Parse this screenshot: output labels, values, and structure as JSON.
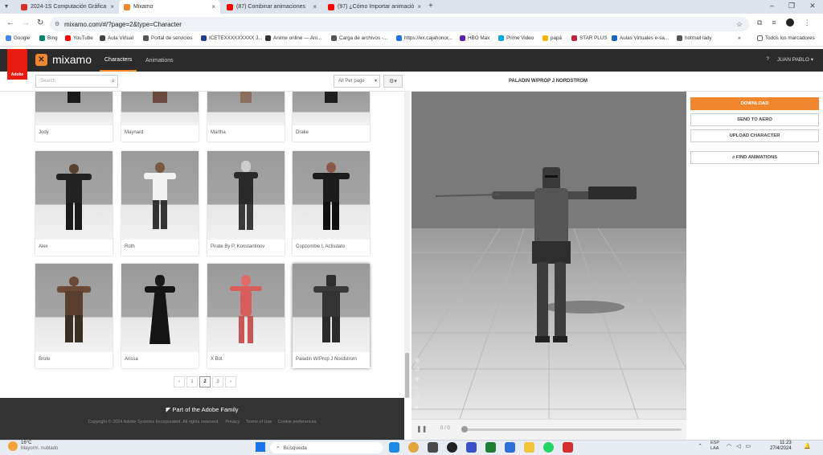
{
  "browser": {
    "tabs": [
      {
        "label": "2024-1S Computación Gráfica",
        "color": "#d93025"
      },
      {
        "label": "Mixamo",
        "color": "#f0872e"
      },
      {
        "label": "(87) Combinar animaciones",
        "color": "#ff0000"
      },
      {
        "label": "(97) ¿Cómo Importar animació",
        "color": "#ff0000"
      }
    ],
    "url": "mixamo.com/#/?page=2&type=Character",
    "bookmarks": [
      {
        "label": "Google",
        "color": "#4285f4"
      },
      {
        "label": "Bing",
        "color": "#008373"
      },
      {
        "label": "YouTube",
        "color": "#ff0000"
      },
      {
        "label": "Aula Virtual",
        "color": "#444444"
      },
      {
        "label": "Portal de servicios",
        "color": "#555555"
      },
      {
        "label": "ICETEXXXXXXXXX J...",
        "color": "#1a3d8f"
      },
      {
        "label": "Anime online — Ani...",
        "color": "#333333"
      },
      {
        "label": "Carga de archivos -...",
        "color": "#555555"
      },
      {
        "label": "https://ex.cajahonor...",
        "color": "#1a73e8"
      },
      {
        "label": "HBO Max",
        "color": "#5822b4"
      },
      {
        "label": "Prime Video",
        "color": "#00a8e1"
      },
      {
        "label": "papá",
        "color": "#f4b400"
      },
      {
        "label": "STAR PLUS",
        "color": "#c41e3a"
      },
      {
        "label": "Aulas Virtuales e-sa...",
        "color": "#1565c0"
      },
      {
        "label": "hotmail lady",
        "color": "#555555"
      }
    ],
    "all_bookmarks": "Todos los marcadores"
  },
  "header": {
    "brand": "mixamo",
    "adobe": "Adobe",
    "nav": [
      "Characters",
      "Animations"
    ],
    "user": "JUAN PABLO"
  },
  "toolbar": {
    "search_placeholder": "Search",
    "per_page": "All Per page"
  },
  "characters": [
    {
      "name": "Jody",
      "skin": "#2b2b2b",
      "cloth": "#1a1a1a"
    },
    {
      "name": "Maynard",
      "skin": "#b98b73",
      "cloth": "#6a4a3e"
    },
    {
      "name": "Martha",
      "skin": "#c9a58a",
      "cloth": "#5d4a40"
    },
    {
      "name": "Drake",
      "skin": "#3a3a3a",
      "cloth": "#1e1e1e"
    },
    {
      "name": "Alex",
      "skin": "#7a5a47",
      "cloth": "#202020"
    },
    {
      "name": "Roth",
      "skin": "#8a6a55",
      "cloth": "#f2f2f2"
    },
    {
      "name": "Pirate By P. Konstantinov",
      "skin": "#c8b8a8",
      "cloth": "#2a2a2a"
    },
    {
      "name": "Copzombie L Actisdato",
      "skin": "#8a5a4a",
      "cloth": "#1c1c1c"
    },
    {
      "name": "Brute",
      "skin": "#6b4a38",
      "cloth": "#3a3026"
    },
    {
      "name": "Arissa",
      "skin": "#a07a60",
      "cloth": "#141414"
    },
    {
      "name": "X Bot",
      "skin": "#e06a68",
      "cloth": "#c95654"
    },
    {
      "name": "Paladin W/Prop J Nordstrom",
      "skin": "#3a3a3a",
      "cloth": "#2a2a2a"
    }
  ],
  "pagination": [
    "‹",
    "1",
    "2",
    "3",
    "›"
  ],
  "footer": {
    "title": "Part of the Adobe Family",
    "copyright": "Copyright © 2024 Adobe Systems Incorporated. All rights reserved.",
    "privacy": "Privacy",
    "terms": "Terms of Use",
    "cookies": "Cookie preferences"
  },
  "viewer": {
    "title": "PALADIN W/PROP J NORDSTROM",
    "time": "0 / 0"
  },
  "actions": {
    "download": "DOWNLOAD",
    "send": "SEND TO AERO",
    "upload": "UPLOAD CHARACTER",
    "find": "FIND ANIMATIONS"
  },
  "taskbar": {
    "temp": "16°C",
    "weather": "Mayorm. nublado",
    "search": "Búsqueda",
    "lang": "ESP\nLAA",
    "time": "11:23",
    "date": "27/4/2024"
  }
}
